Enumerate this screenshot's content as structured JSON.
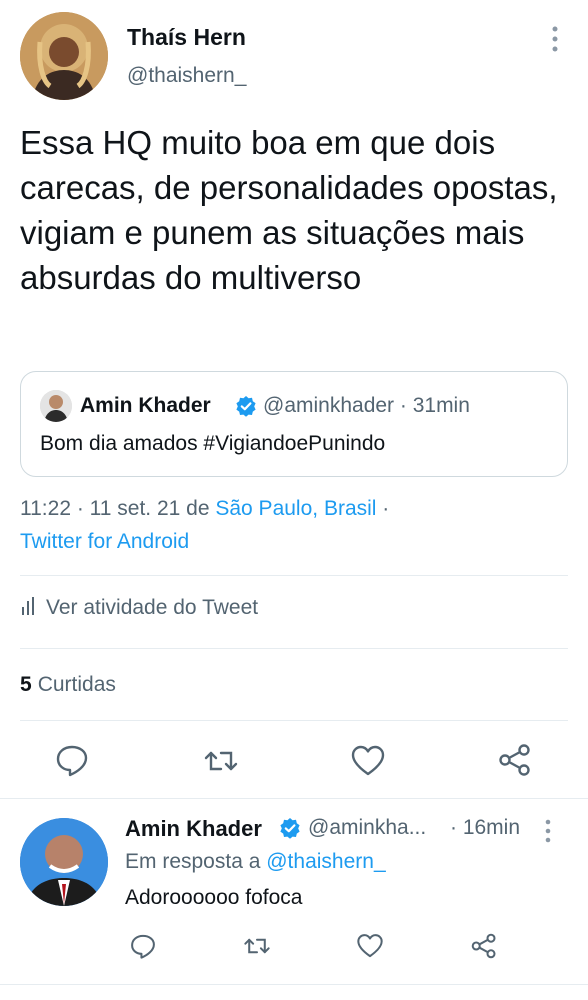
{
  "tweet": {
    "author_name": "Thaís Hern",
    "author_handle": "@thaishern_",
    "text": "Essa HQ muito boa em que dois carecas, de personalidades opostas, vigiam e punem as situações mais absurdas do multiverso",
    "time_date_prefix": "11:22 · 11 set. 21 de ",
    "location": "São Paulo, Brasil",
    "location_sep": " ·",
    "source": "Twitter for Android",
    "activity_label": "Ver atividade do Tweet",
    "likes_count": "5",
    "likes_label": "Curtidas",
    "quote": {
      "author_name": "Amin Khader",
      "author_handle": "@aminkhader · 31min",
      "text": "Bom dia amados #VigiandoePunindo"
    }
  },
  "reply": {
    "author_name": "Amin Khader",
    "author_handle": "@aminkha...",
    "time": "· 16min",
    "reply_to_prefix": "Em resposta a ",
    "reply_to_handle": "@thaishern_",
    "text": "Adoroooooo fofoca"
  },
  "icons": {
    "more": "vertical-dots-icon",
    "verified": "verified-badge-icon",
    "activity": "bar-chart-icon",
    "reply": "speech-bubble-icon",
    "retweet": "retweet-icon",
    "like": "heart-icon",
    "share": "share-icon"
  },
  "colors": {
    "text_primary": "#0f1419",
    "text_secondary": "#536471",
    "link": "#1d9bf0",
    "verified": "#1d9bf0",
    "divider": "#e6ecf0"
  }
}
